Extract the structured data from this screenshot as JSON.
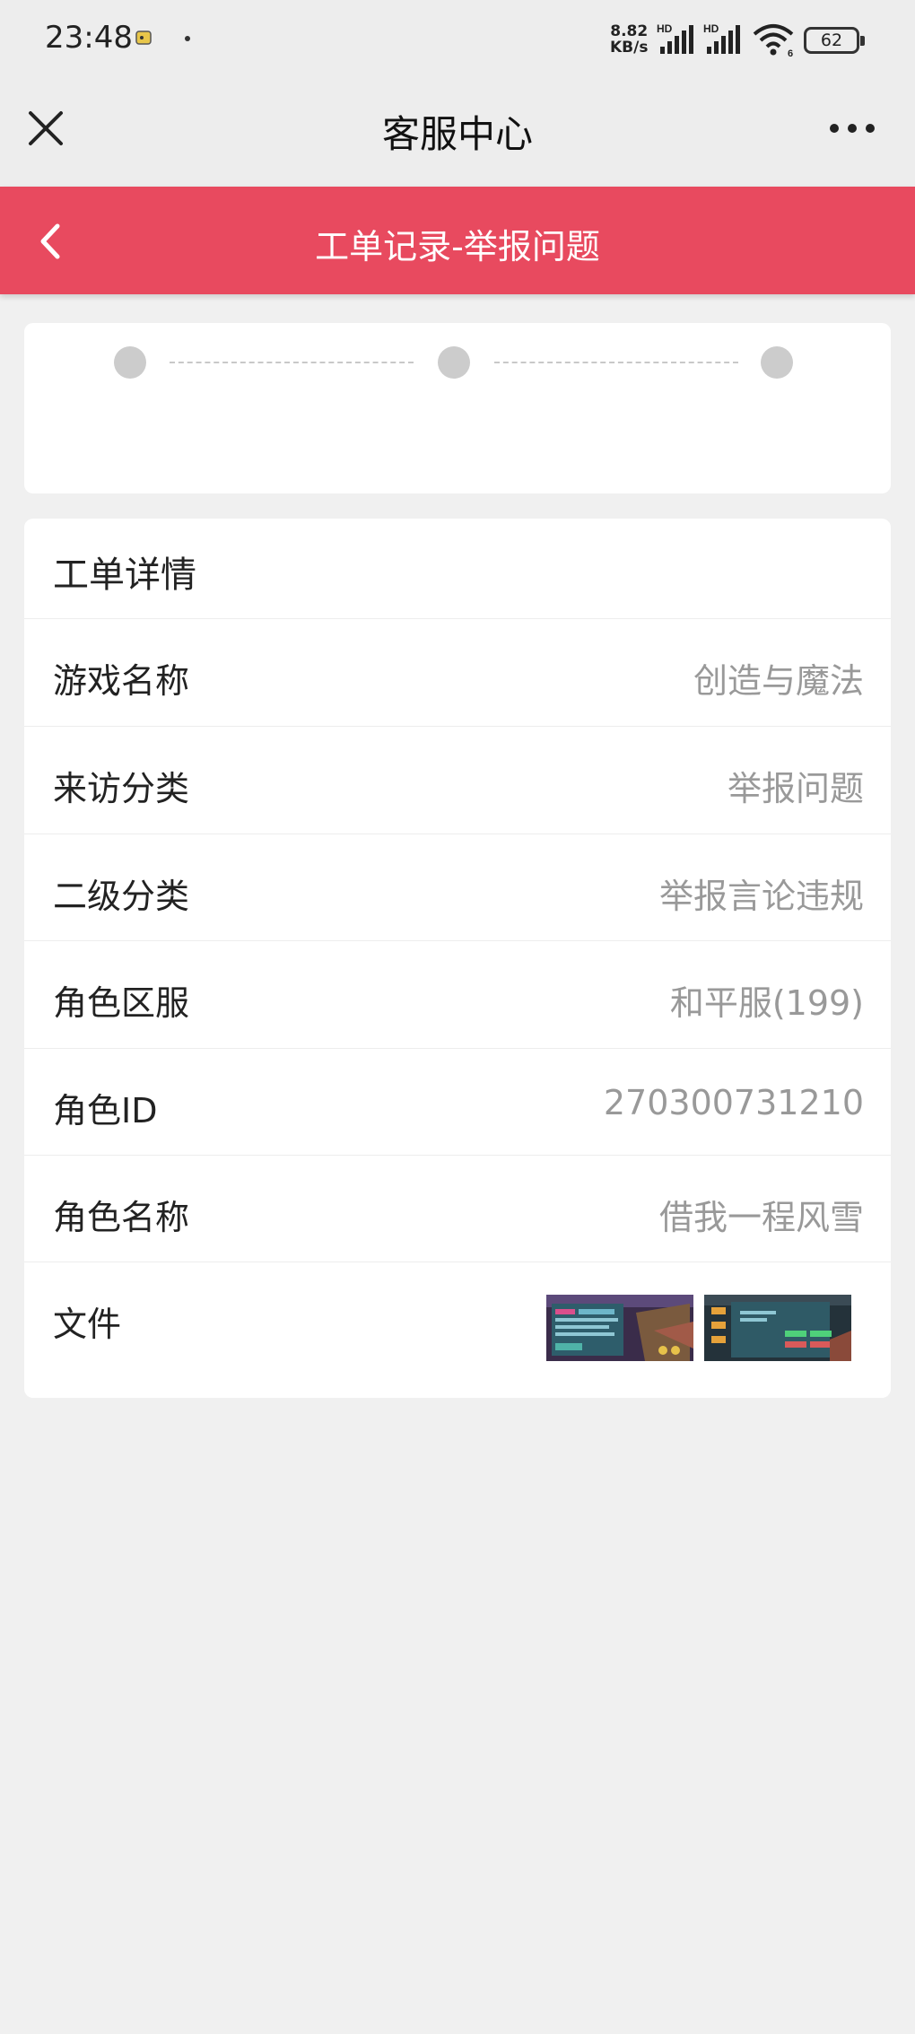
{
  "status_bar": {
    "time": "23:48",
    "net_speed_value": "8.82",
    "net_speed_unit": "KB/s",
    "hd1": "HD",
    "hd2": "HD",
    "wifi_sub": "6",
    "battery": "62",
    "icons": [
      "notification-app-icon",
      "signal-icon",
      "signal-icon",
      "wifi-icon",
      "battery-icon"
    ]
  },
  "nav": {
    "title": "客服中心",
    "close_icon": "close-icon",
    "more_icon": "more-icon"
  },
  "header": {
    "title": "工单记录-举报问题",
    "back_icon": "chevron-left-icon",
    "color": "#e84a5f"
  },
  "progress": {
    "step_count": 3,
    "dot_color": "#cccccc"
  },
  "detail": {
    "heading": "工单详情",
    "rows": [
      {
        "label": "游戏名称",
        "value": "创造与魔法"
      },
      {
        "label": "来访分类",
        "value": "举报问题"
      },
      {
        "label": "二级分类",
        "value": "举报言论违规"
      },
      {
        "label": "角色区服",
        "value": "和平服(199)"
      },
      {
        "label": "角色ID",
        "value": "270300731210"
      },
      {
        "label": "角色名称",
        "value": "借我一程风雪"
      }
    ],
    "files_label": "文件",
    "files": [
      "attachment-thumbnail-1",
      "attachment-thumbnail-2"
    ]
  }
}
